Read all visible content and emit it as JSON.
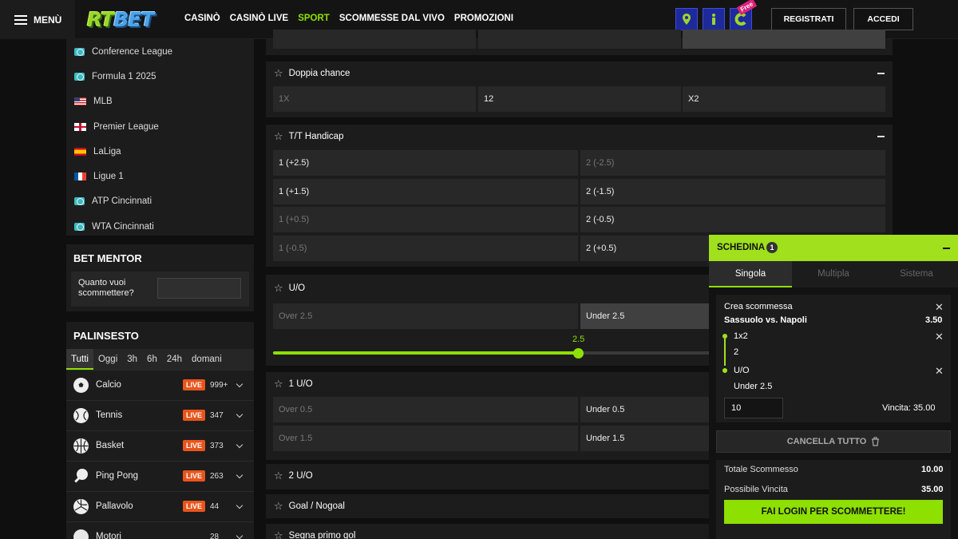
{
  "header": {
    "menu_label": "MENÙ",
    "logo_rt": "RT",
    "logo_bet": "BET",
    "nav": [
      "CASINÒ",
      "CASINÒ LIVE",
      "SPORT",
      "SCOMMESSE DAL VIVO",
      "PROMOZIONI"
    ],
    "free_label": "Free",
    "register_label": "REGISTRATI",
    "login_label": "ACCEDI"
  },
  "leagues": [
    {
      "label": "Conference League",
      "flag": "globe"
    },
    {
      "label": "Formula 1 2025",
      "flag": "globe"
    },
    {
      "label": "MLB",
      "flag": "us"
    },
    {
      "label": "Premier League",
      "flag": "england"
    },
    {
      "label": "LaLiga",
      "flag": "spain"
    },
    {
      "label": "Ligue 1",
      "flag": "france"
    },
    {
      "label": "ATP Cincinnati",
      "flag": "globe"
    },
    {
      "label": "WTA Cincinnati",
      "flag": "globe"
    }
  ],
  "bet_mentor": {
    "title": "BET MENTOR",
    "question": "Quanto vuoi scommettere?"
  },
  "palinsesto": {
    "title": "PALINSESTO",
    "filters": [
      "Tutti",
      "Oggi",
      "3h",
      "6h",
      "24h",
      "domani"
    ],
    "sports": [
      {
        "name": "Calcio",
        "live": "LIVE",
        "count": "999+"
      },
      {
        "name": "Tennis",
        "live": "LIVE",
        "count": "347"
      },
      {
        "name": "Basket",
        "live": "LIVE",
        "count": "373"
      },
      {
        "name": "Ping Pong",
        "live": "LIVE",
        "count": "263"
      },
      {
        "name": "Pallavolo",
        "live": "LIVE",
        "count": "44"
      },
      {
        "name": "Motori",
        "live": "",
        "count": "28"
      }
    ]
  },
  "markets": {
    "doppia": {
      "title": "Doppia chance",
      "odds": [
        "1X",
        "12",
        "X2"
      ]
    },
    "tt_handicap": {
      "title": "T/T Handicap",
      "odds": [
        "1 (+2.5)",
        "2 (-2.5)",
        "1 (+1.5)",
        "2 (-1.5)",
        "1 (+0.5)",
        "2 (-0.5)",
        "1 (-0.5)",
        "2 (+0.5)"
      ]
    },
    "uo": {
      "title": "U/O",
      "odds": [
        "Over 2.5",
        "Under 2.5"
      ],
      "slider_value": "2.5"
    },
    "uo1": {
      "title": "1 U/O",
      "odds": [
        "Over 0.5",
        "Under 0.5",
        "Over 1.5",
        "Under 1.5"
      ]
    },
    "uo2": {
      "title": "2 U/O"
    },
    "goal": {
      "title": "Goal / Nogoal"
    },
    "primo_gol": {
      "title": "Segna primo gol"
    }
  },
  "betslip": {
    "title": "SCHEDINA",
    "count": "1",
    "tabs": [
      "Singola",
      "Multipla",
      "Sistema"
    ],
    "create_label": "Crea scommessa",
    "match": "Sassuolo vs. Napoli",
    "match_odds": "3.50",
    "sel1_market": "1x2",
    "sel1_pick": "2",
    "sel2_market": "U/O",
    "sel2_pick": "Under 2.5",
    "stake": "10",
    "win_label": "Vincita: 35.00",
    "cancel_label": "CANCELLA TUTTO",
    "total_label": "Totale Scommesso",
    "total_value": "10.00",
    "possible_label": "Possibile Vincita",
    "possible_value": "35.00",
    "login_cta": "FAI LOGIN PER SCOMMETTERE!"
  },
  "colors": {
    "accent": "#8ee000",
    "live": "#e8551c",
    "slip_head": "#a0e01c"
  }
}
